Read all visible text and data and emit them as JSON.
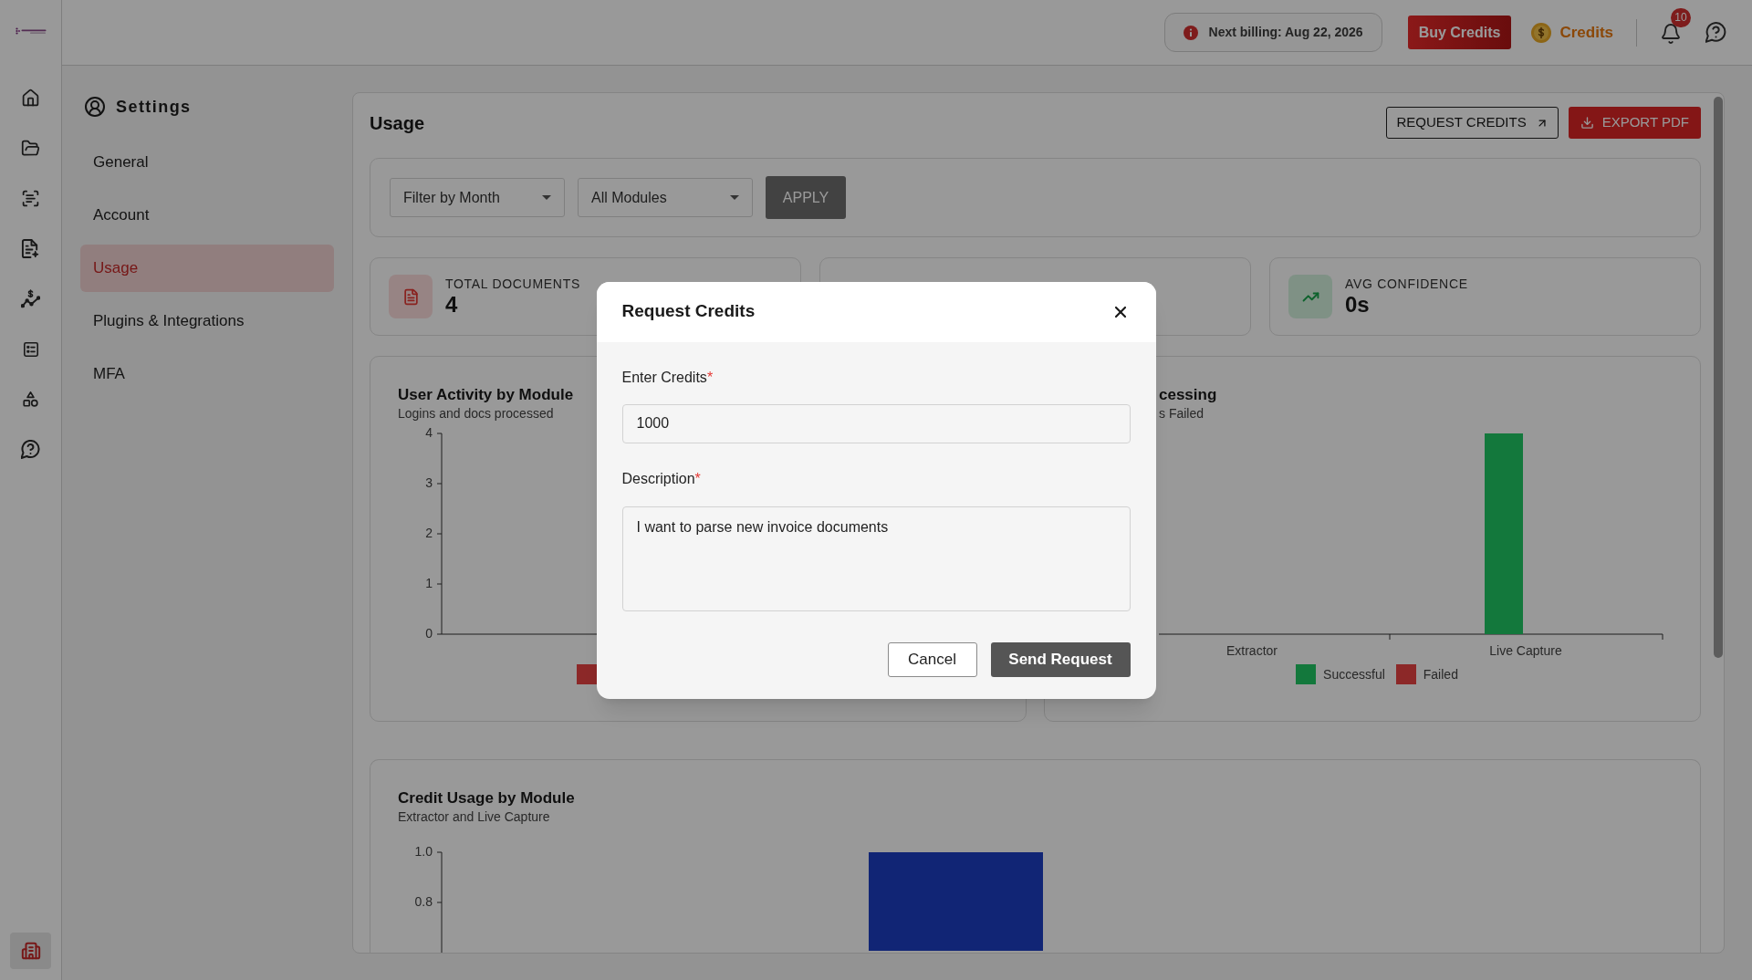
{
  "top_bar": {
    "billing_notice": "Next billing: Aug 22, 2026",
    "buy_button": "Buy Credits",
    "credits_link": "Credits",
    "notification_count": "10"
  },
  "settings_nav": {
    "title": "Settings",
    "items": [
      {
        "label": "General",
        "selected": false
      },
      {
        "label": "Account",
        "selected": false
      },
      {
        "label": "Usage",
        "selected": true
      },
      {
        "label": "Plugins & Integrations",
        "selected": false
      },
      {
        "label": "MFA",
        "selected": false
      }
    ]
  },
  "usage": {
    "title": "Usage",
    "actions": [
      {
        "kind": "outline",
        "label": "REQUEST CREDITS"
      },
      {
        "kind": "export",
        "label": "EXPORT PDF"
      }
    ],
    "filters": [
      {
        "value": "Filter by Month"
      },
      {
        "value": "All Modules"
      }
    ],
    "apply_button": "APPLY",
    "stats": [
      {
        "kind": "documents",
        "label": "TOTAL DOCUMENTS",
        "value": "4"
      },
      {
        "kind": "covered"
      },
      {
        "kind": "confidence",
        "label": "AVG CONFIDENCE",
        "value": "0s"
      }
    ],
    "charts": [
      {
        "kind": "activity",
        "title": "User Activity by Module",
        "subtitle": "Logins and docs processed",
        "y_ticks": [
          "4",
          "3",
          "2",
          "1",
          "0"
        ],
        "legend": [
          {
            "color": "#8c2828"
          }
        ]
      },
      {
        "kind": "processing",
        "title": "cessing",
        "subtitle": "s Failed",
        "categories": [
          "Extractor",
          "Live Capture"
        ],
        "legend": [
          {
            "label": "Successful",
            "color": "#14783c"
          },
          {
            "label": "Failed",
            "color": "#8c2828"
          }
        ]
      }
    ],
    "credit_chart": {
      "title": "Credit Usage by Module",
      "subtitle": "Extractor and Live Capture",
      "y_ticks": [
        "1.0",
        "0.8"
      ]
    }
  },
  "dialog": {
    "title": "Request Credits",
    "fields": [
      {
        "kind": "input",
        "label": "Enter Credits",
        "required_mark": "*",
        "value": "1000"
      },
      {
        "kind": "textarea",
        "label": "Description",
        "required_mark": "*",
        "value": "I want to parse new invoice documents"
      }
    ],
    "buttons": [
      {
        "kind": "secondary",
        "label": "Cancel"
      },
      {
        "kind": "primary",
        "label": "Send Request"
      }
    ]
  }
}
